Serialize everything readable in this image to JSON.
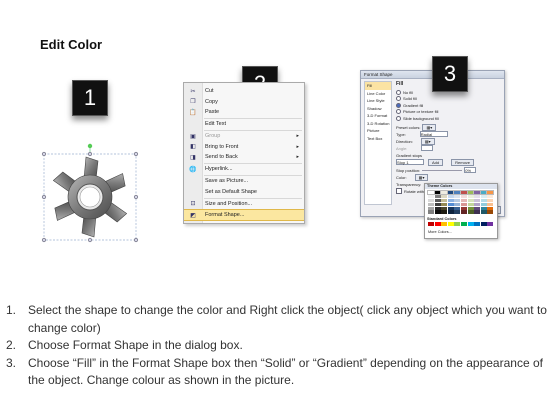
{
  "title": "Edit Color",
  "steps_badges": [
    "1",
    "2",
    "3"
  ],
  "context_menu": {
    "items": [
      {
        "icon": "scissors-icon",
        "glyph": "✂",
        "label": "Cut",
        "disabled": false,
        "submenu": false
      },
      {
        "icon": "copy-icon",
        "glyph": "❐",
        "label": "Copy",
        "disabled": false,
        "submenu": false
      },
      {
        "icon": "paste-icon",
        "glyph": "📋",
        "label": "Paste",
        "disabled": false,
        "submenu": false
      },
      {
        "icon": "edit-text-icon",
        "glyph": "",
        "label": "Edit Text",
        "disabled": false,
        "submenu": false
      },
      {
        "icon": "group-icon",
        "glyph": "▣",
        "label": "Group",
        "disabled": true,
        "submenu": true
      },
      {
        "icon": "bring-to-front-icon",
        "glyph": "◧",
        "label": "Bring to Front",
        "disabled": false,
        "submenu": true
      },
      {
        "icon": "send-to-back-icon",
        "glyph": "◨",
        "label": "Send to Back",
        "disabled": false,
        "submenu": true
      },
      {
        "icon": "hyperlink-icon",
        "glyph": "🌐",
        "label": "Hyperlink...",
        "disabled": false,
        "submenu": false
      },
      {
        "icon": "save-picture-icon",
        "glyph": "",
        "label": "Save as Picture...",
        "disabled": false,
        "submenu": false
      },
      {
        "icon": "default-shape-icon",
        "glyph": "",
        "label": "Set as Default Shape",
        "disabled": false,
        "submenu": false
      },
      {
        "icon": "size-position-icon",
        "glyph": "⊡",
        "label": "Size and Position...",
        "disabled": false,
        "submenu": false
      },
      {
        "icon": "format-shape-icon",
        "glyph": "◩",
        "label": "Format Shape...",
        "disabled": false,
        "submenu": false,
        "highlighted": true
      }
    ]
  },
  "dialog": {
    "title": "Format Shape",
    "sidebar": [
      "Fill",
      "Line Color",
      "Line Style",
      "Shadow",
      "3-D Format",
      "3-D Rotation",
      "Picture",
      "Text Box"
    ],
    "section": "Fill",
    "fill_options": [
      "No fill",
      "Solid fill",
      "Gradient fill",
      "Picture or texture fill",
      "Slide background fill"
    ],
    "selected_fill": "Gradient fill",
    "labels": {
      "preset": "Preset colors:",
      "type": "Type:",
      "type_value": "Radial",
      "direction": "Direction:",
      "angle": "Angle:",
      "stops": "Gradient stops",
      "stop_value": "Stop 1",
      "add": "Add",
      "remove": "Remove",
      "stop_position": "Stop position:",
      "stop_pct": "0%",
      "color": "Color:",
      "transparency": "Transparency:",
      "rotate": "Rotate with shape",
      "close": "Close"
    }
  },
  "color_popup": {
    "header": "Theme Colors",
    "standard": "Standard Colors",
    "more": "More Colors...",
    "theme_top": [
      "#ffffff",
      "#000000",
      "#eeece1",
      "#1f497d",
      "#4f81bd",
      "#c0504d",
      "#9bbb59",
      "#8064a2",
      "#4bacc6",
      "#f79646"
    ],
    "theme_cols": [
      [
        "#f2f2f2",
        "#d9d9d9",
        "#bfbfbf",
        "#a6a6a6",
        "#808080"
      ],
      [
        "#7f7f7f",
        "#595959",
        "#404040",
        "#262626",
        "#0d0d0d"
      ],
      [
        "#ddd9c3",
        "#c4bd97",
        "#948a54",
        "#4a452a",
        "#1e1c11"
      ],
      [
        "#c6d9f0",
        "#8db3e2",
        "#548dd4",
        "#17365d",
        "#0f243e"
      ],
      [
        "#dbe5f1",
        "#b8cce4",
        "#95b3d7",
        "#366092",
        "#244061"
      ],
      [
        "#f2dcdb",
        "#e5b9b7",
        "#d99694",
        "#953734",
        "#632423"
      ],
      [
        "#ebf1dd",
        "#d7e3bc",
        "#c3d69b",
        "#76923c",
        "#4f6128"
      ],
      [
        "#e5e0ec",
        "#ccc1d9",
        "#b2a2c7",
        "#5f497a",
        "#3f3151"
      ],
      [
        "#dbeef3",
        "#b7dde8",
        "#92cddc",
        "#31859b",
        "#205867"
      ],
      [
        "#fdeada",
        "#fbd5b5",
        "#fac08f",
        "#e36c09",
        "#974806"
      ]
    ],
    "standard_colors": [
      "#c00000",
      "#ff0000",
      "#ffc000",
      "#ffff00",
      "#92d050",
      "#00b050",
      "#00b0f0",
      "#0070c0",
      "#002060",
      "#7030a0"
    ]
  },
  "instructions": [
    {
      "num": "1.",
      "text": "Select the shape to change the color and Right click the object( click any object which you want to change color)"
    },
    {
      "num": "2.",
      "text": "Choose Format Shape in the dialog box."
    },
    {
      "num": "3.",
      "text": "Choose “Fill” in the Format Shape box then “Solid” or “Gradient” depending on the appearance of the object. Change colour as shown in the picture."
    }
  ]
}
